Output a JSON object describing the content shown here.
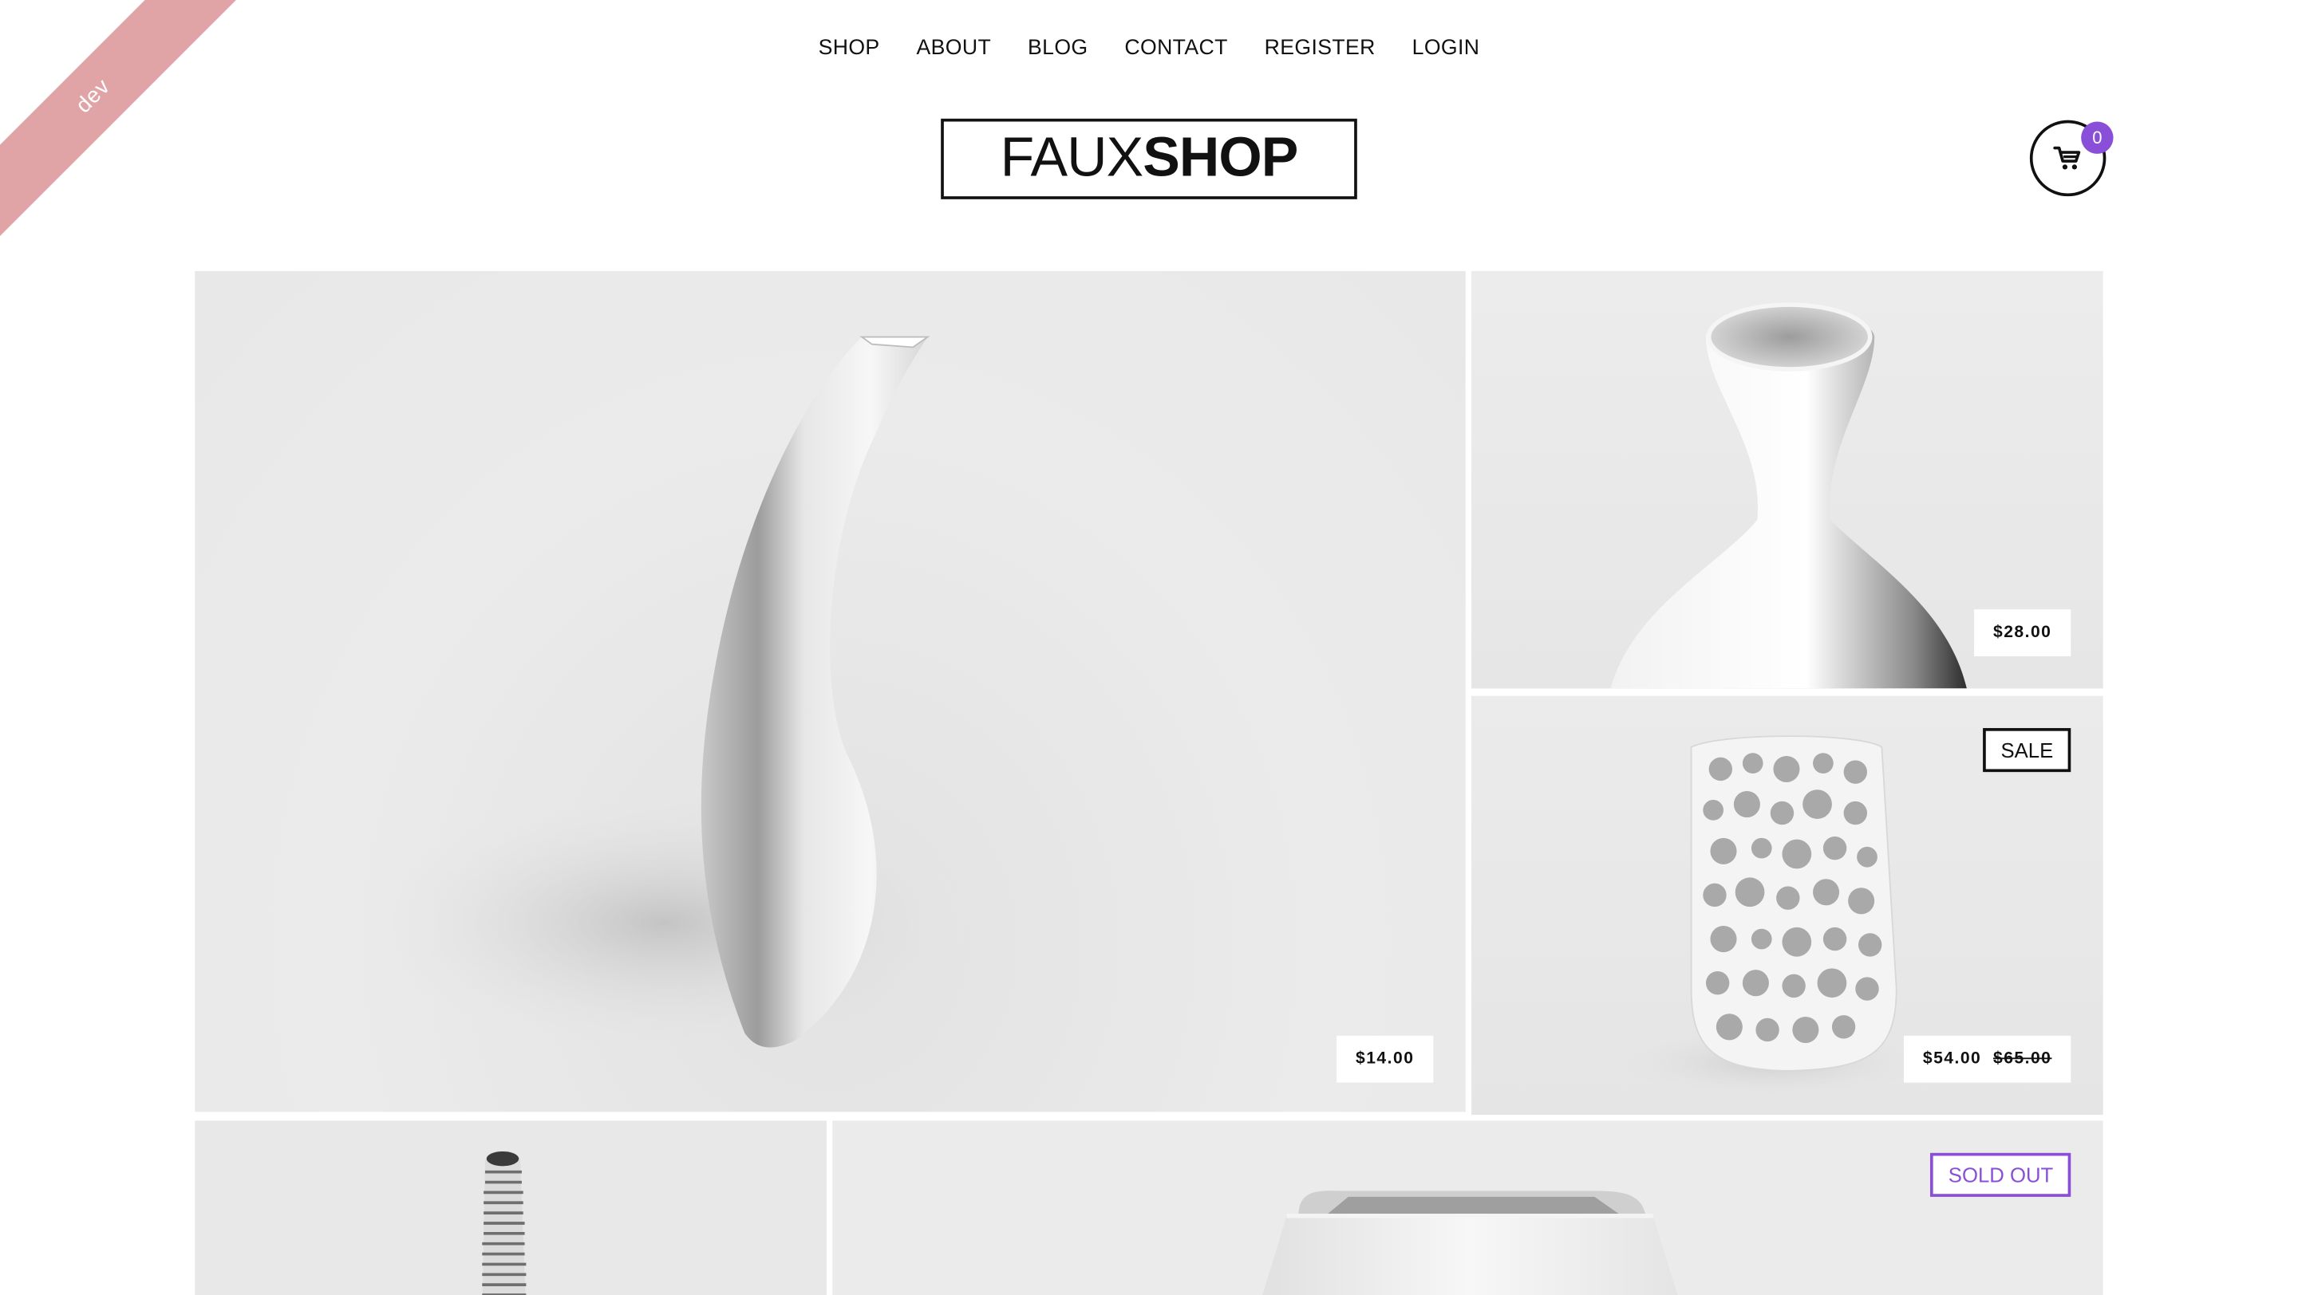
{
  "ribbon": {
    "label": "dev"
  },
  "nav": {
    "items": [
      {
        "label": "SHOP"
      },
      {
        "label": "ABOUT"
      },
      {
        "label": "BLOG"
      },
      {
        "label": "CONTACT"
      },
      {
        "label": "REGISTER"
      },
      {
        "label": "LOGIN"
      }
    ]
  },
  "logo": {
    "thin": "FAUX",
    "bold": "SHOP"
  },
  "cart": {
    "count": "0",
    "icon": "cart-icon"
  },
  "products": [
    {
      "price": "$14.00",
      "image": "curved-vase"
    },
    {
      "price": "$28.00",
      "image": "flask-vase"
    },
    {
      "price": "$54.00",
      "old_price": "$65.00",
      "badge": "SALE",
      "image": "perforated-vase"
    },
    {
      "image": "ribbed-tube-vase"
    },
    {
      "badge": "SOLD OUT",
      "image": "trapezoid-planter"
    }
  ],
  "colors": {
    "accent": "#8a4fd8",
    "ribbon": "#e0a3a6",
    "tile_bg": "#e9e9e9",
    "text": "#111111"
  }
}
